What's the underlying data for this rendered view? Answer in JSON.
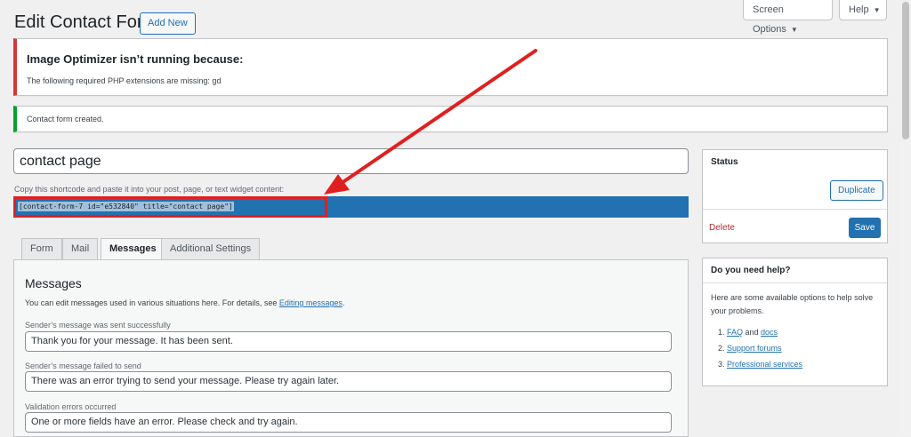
{
  "header": {
    "title": "Edit Contact Form",
    "add_new": "Add New",
    "screen_options": "Screen Options",
    "help": "Help"
  },
  "notices": {
    "error_title": "Image Optimizer isn’t running because:",
    "error_text": "The following required PHP extensions are missing: gd",
    "success_text": "Contact form created."
  },
  "form": {
    "title_value": "contact page",
    "shortcode_label": "Copy this shortcode and paste it into your post, page, or text widget content:",
    "shortcode": "[contact-form-7 id=\"e532840\" title=\"contact page\"]"
  },
  "tabs": [
    "Form",
    "Mail",
    "Messages",
    "Additional Settings"
  ],
  "messages": {
    "heading": "Messages",
    "desc_prefix": "You can edit messages used in various situations here. For details, see ",
    "desc_link": "Editing messages",
    "desc_suffix": ".",
    "fields": [
      {
        "label": "Sender’s message was sent successfully",
        "value": "Thank you for your message. It has been sent."
      },
      {
        "label": "Sender’s message failed to send",
        "value": "There was an error trying to send your message. Please try again later."
      },
      {
        "label": "Validation errors occurred",
        "value": "One or more fields have an error. Please check and try again."
      }
    ]
  },
  "status": {
    "heading": "Status",
    "duplicate": "Duplicate",
    "delete": "Delete",
    "save": "Save"
  },
  "help_box": {
    "heading": "Do you need help?",
    "text": "Here are some available options to help solve your problems.",
    "item1_num": "1.",
    "item1_link_a": "FAQ",
    "item1_and": " and ",
    "item1_link_b": "docs",
    "item2_link": "Support forums",
    "item3_link": "Professional services"
  },
  "colors": {
    "accent": "#2271b1",
    "error": "#d63638",
    "success": "#00a32a",
    "annotation": "#e0201f"
  }
}
